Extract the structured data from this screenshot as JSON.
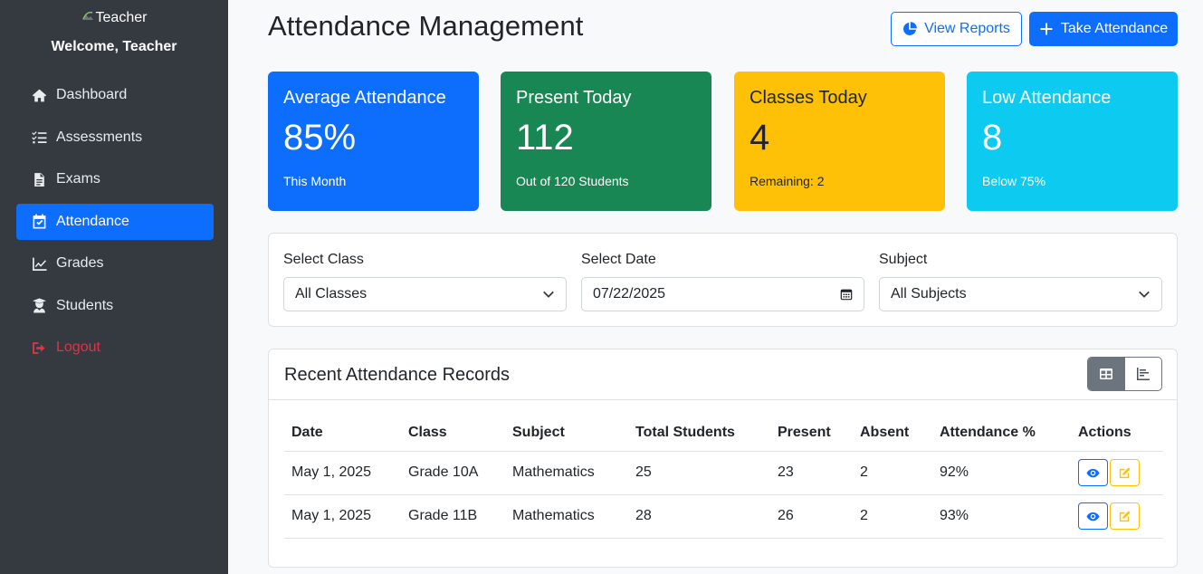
{
  "sidebar": {
    "logo_alt": "Teacher",
    "welcome": "Welcome, Teacher",
    "items": [
      {
        "label": "Dashboard",
        "icon": "home-icon"
      },
      {
        "label": "Assessments",
        "icon": "tasks-icon"
      },
      {
        "label": "Exams",
        "icon": "file-icon"
      },
      {
        "label": "Attendance",
        "icon": "calendar-check-icon",
        "active": true
      },
      {
        "label": "Grades",
        "icon": "chart-line-icon"
      },
      {
        "label": "Students",
        "icon": "user-graduate-icon"
      },
      {
        "label": "Logout",
        "icon": "sign-out-icon"
      }
    ]
  },
  "header": {
    "title": "Attendance Management",
    "view_reports": "View Reports",
    "take_attendance": "Take Attendance"
  },
  "cards": [
    {
      "title": "Average Attendance",
      "value": "85%",
      "sub": "This Month",
      "color": "#0d6efd"
    },
    {
      "title": "Present Today",
      "value": "112",
      "sub": "Out of 120 Students",
      "color": "#198754"
    },
    {
      "title": "Classes Today",
      "value": "4",
      "sub": "Remaining: 2",
      "color": "#ffc107"
    },
    {
      "title": "Low Attendance",
      "value": "8",
      "sub": "Below 75%",
      "color": "#0dcaf0"
    }
  ],
  "filters": {
    "class_label": "Select Class",
    "class_value": "All Classes",
    "date_label": "Select Date",
    "date_value": "07/22/2025",
    "subject_label": "Subject",
    "subject_value": "All Subjects"
  },
  "records": {
    "title": "Recent Attendance Records",
    "columns": [
      "Date",
      "Class",
      "Subject",
      "Total Students",
      "Present",
      "Absent",
      "Attendance %",
      "Actions"
    ],
    "rows": [
      {
        "date": "May 1, 2025",
        "class": "Grade 10A",
        "subject": "Mathematics",
        "total": "25",
        "present": "23",
        "absent": "2",
        "pct": "92%"
      },
      {
        "date": "May 1, 2025",
        "class": "Grade 11B",
        "subject": "Mathematics",
        "total": "28",
        "present": "26",
        "absent": "2",
        "pct": "93%"
      }
    ]
  }
}
